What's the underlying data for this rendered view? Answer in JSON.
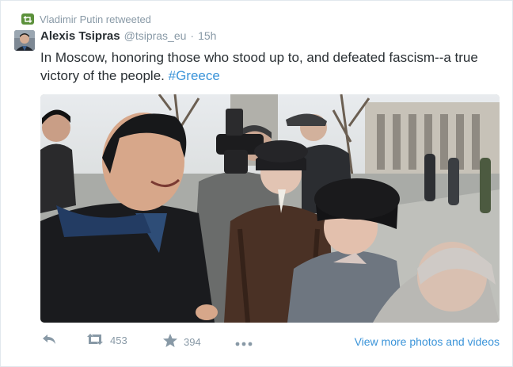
{
  "context": {
    "label": "Vladimir Putin retweeted",
    "icon": "retweet-badge-icon",
    "badge_color": "#5c913b"
  },
  "tweet": {
    "author_name": "Alexis Tsipras",
    "handle": "@tsipras_eu",
    "separator": "·",
    "time": "15h",
    "text": "In Moscow, honoring those who stood up to, and defeated fascism--a true victory of the people.",
    "hashtag": "#Greece"
  },
  "actions": {
    "reply_icon": "reply-icon",
    "retweet_icon": "retweet-icon",
    "retweet_count": "453",
    "favorite_icon": "star-icon",
    "favorite_count": "394",
    "more_icon": "more-dots-icon",
    "view_more": "View more photos and videos"
  },
  "colors": {
    "link": "#3b94d9",
    "muted": "#8899a6",
    "text": "#292f33"
  }
}
